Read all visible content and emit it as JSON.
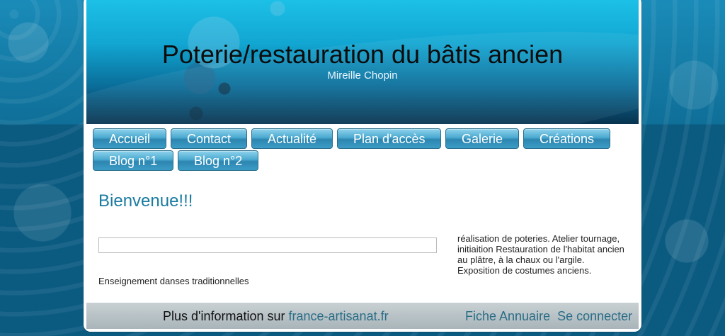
{
  "header": {
    "title": "Poterie/restauration du bâtis ancien",
    "subtitle": "Mireille Chopin"
  },
  "nav": {
    "items": [
      {
        "label": "Accueil"
      },
      {
        "label": "Contact"
      },
      {
        "label": "Actualité"
      },
      {
        "label": "Plan d'accès"
      },
      {
        "label": "Galerie"
      },
      {
        "label": "Créations"
      },
      {
        "label": "Blog n°1"
      },
      {
        "label": "Blog n°2"
      }
    ]
  },
  "main": {
    "welcome": "Bienvenue!!!",
    "left_text": "Enseignement danses traditionnelles",
    "right_text_lines": [
      "réalisation de poteries. Atelier tournage,",
      "initiaition Restauration de l'habitat ancien",
      "au plâtre, à la chaux ou l'argile.",
      "Exposition de costumes anciens."
    ]
  },
  "footer": {
    "info_prefix": "Plus d'information sur ",
    "info_link": "france-artisanat.fr",
    "fiche": "Fiche Annuaire",
    "login": "Se connecter"
  }
}
